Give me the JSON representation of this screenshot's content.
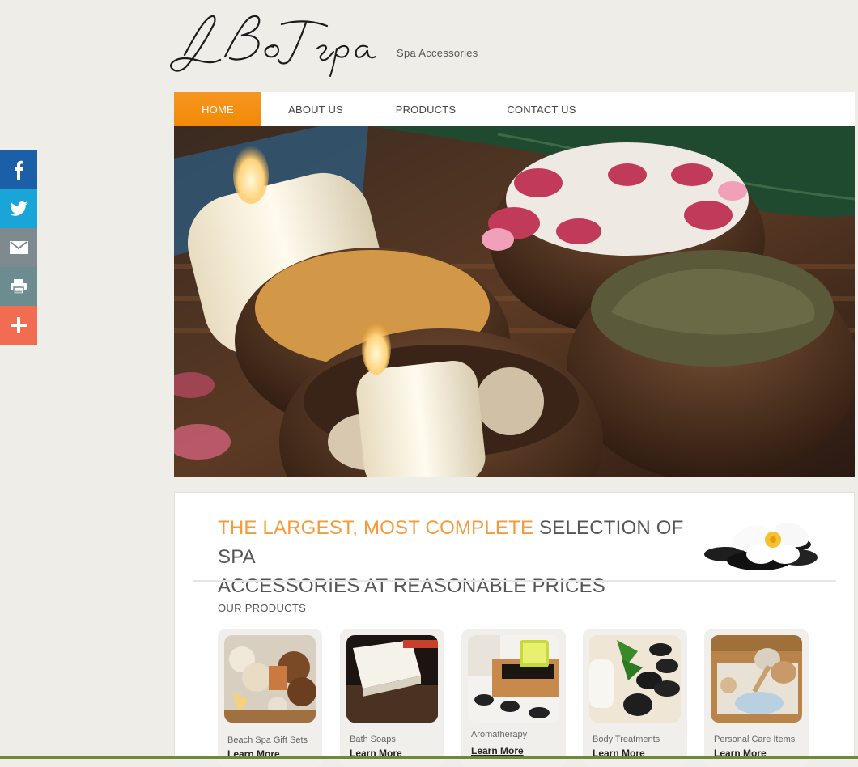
{
  "header": {
    "logo_text": "LBoTspa",
    "tagline": "Spa Accessories"
  },
  "share": [
    {
      "icon": "facebook-icon",
      "color": "#1a5fa8"
    },
    {
      "icon": "twitter-icon",
      "color": "#1aa5d8"
    },
    {
      "icon": "email-icon",
      "color": "#7e8a90"
    },
    {
      "icon": "print-icon",
      "color": "#6c8c90"
    },
    {
      "icon": "plus-icon",
      "color": "#f26c52"
    }
  ],
  "nav": {
    "items": [
      {
        "label": "HOME"
      },
      {
        "label": "ABOUT US"
      },
      {
        "label": "PRODUCTS"
      },
      {
        "label": "CONTACT US"
      }
    ],
    "active_color": "#f28a08"
  },
  "content": {
    "headline_accent": "THE LARGEST, MOST COMPLETE",
    "headline_rest_1": " SELECTION OF SPA",
    "headline_rest_2": "ACCESSORIES AT REASONABLE PRICES",
    "section_title": "OUR PRODUCTS",
    "products": [
      {
        "name": "Beach Spa Gift Sets",
        "link": "Learn More"
      },
      {
        "name": "Bath Soaps",
        "link": "Learn More"
      },
      {
        "name": "Aromatherapy",
        "link": "Learn More"
      },
      {
        "name": "Body Treatments",
        "link": "Learn More"
      },
      {
        "name": "Personal Care Items",
        "link": "Learn More"
      }
    ]
  }
}
